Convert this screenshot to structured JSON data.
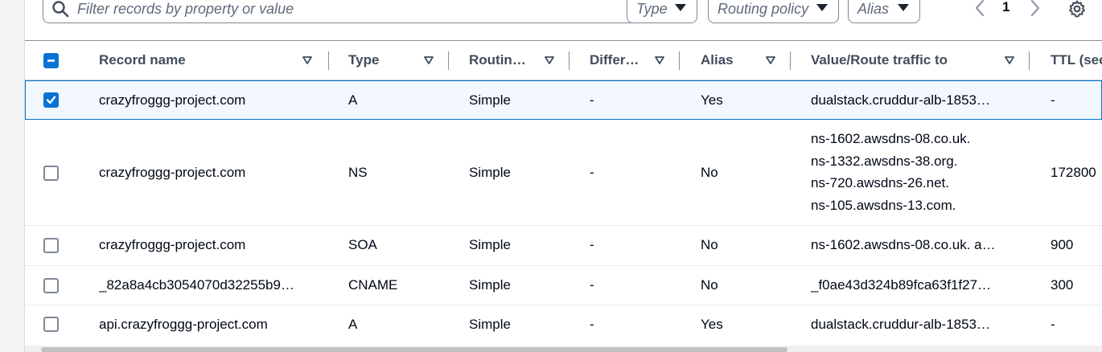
{
  "filter": {
    "placeholder": "Filter records by property or value",
    "type_label": "Type",
    "routing_policy_label": "Routing policy",
    "alias_label": "Alias"
  },
  "pagination": {
    "current_page": "1"
  },
  "columns": {
    "record_name": "Record name",
    "type": "Type",
    "routing": "Routin…",
    "differentiator": "Differ…",
    "alias": "Alias",
    "value": "Value/Route traffic to",
    "ttl": "TTL (sec"
  },
  "rows": [
    {
      "name": "crazyfroggg-project.com",
      "type": "A",
      "routing": "Simple",
      "diff": "-",
      "alias": "Yes",
      "value": "dualstack.cruddur-alb-1853…",
      "ttl": "-",
      "checked": true
    },
    {
      "name": "crazyfroggg-project.com",
      "type": "NS",
      "routing": "Simple",
      "diff": "-",
      "alias": "No",
      "values": [
        "ns-1602.awsdns-08.co.uk.",
        "ns-1332.awsdns-38.org.",
        "ns-720.awsdns-26.net.",
        "ns-105.awsdns-13.com."
      ],
      "ttl": "172800",
      "checked": false
    },
    {
      "name": "crazyfroggg-project.com",
      "type": "SOA",
      "routing": "Simple",
      "diff": "-",
      "alias": "No",
      "value": "ns-1602.awsdns-08.co.uk. a…",
      "ttl": "900",
      "checked": false
    },
    {
      "name": "_82a8a4cb3054070d32255b9…",
      "type": "CNAME",
      "routing": "Simple",
      "diff": "-",
      "alias": "No",
      "value": "_f0ae43d324b89fca63f1f27…",
      "ttl": "300",
      "checked": false
    },
    {
      "name": "api.crazyfroggg-project.com",
      "type": "A",
      "routing": "Simple",
      "diff": "-",
      "alias": "Yes",
      "value": "dualstack.cruddur-alb-1853…",
      "ttl": "-",
      "checked": false
    }
  ],
  "icons": {
    "search": "search-icon",
    "caret": "caret-down-icon",
    "sort": "sort-icon",
    "prev": "chevron-left-icon",
    "next": "chevron-right-icon",
    "settings": "gear-icon"
  },
  "colors": {
    "accent": "#0972d3",
    "selected_row_bg": "#f2f8fd",
    "header_text": "#414d5c",
    "body_text": "#000716"
  }
}
